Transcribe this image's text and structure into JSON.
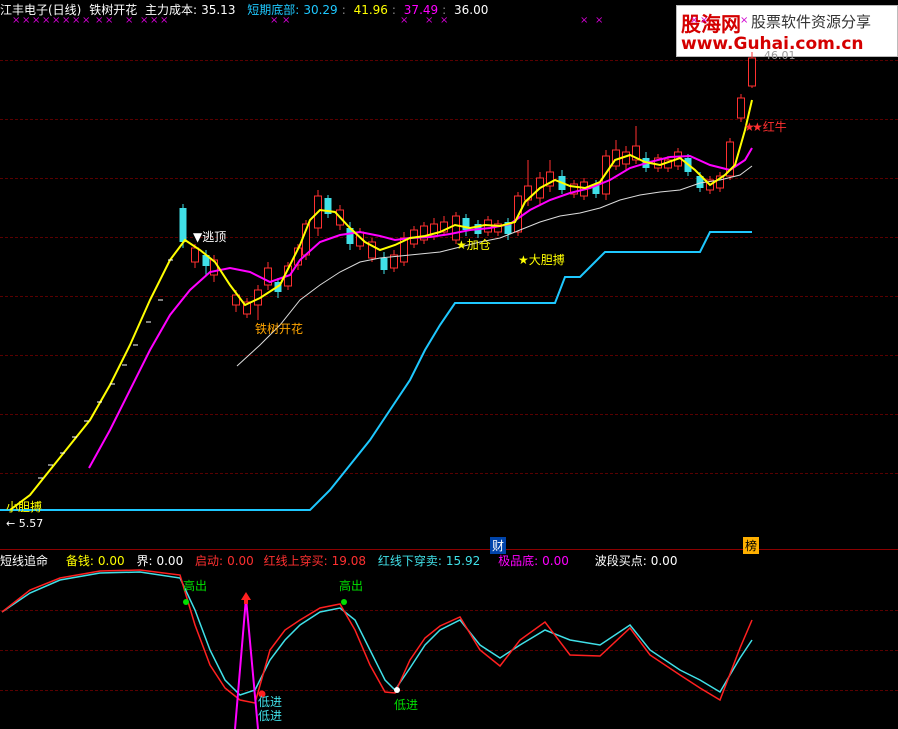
{
  "header": {
    "title": "江丰电子(日线)",
    "indicator": "铁树开花",
    "cost_label": "主力成本:",
    "cost_value": "35.13",
    "bottom_label": "短期底部:",
    "v1": "30.29",
    "v2": "41.96",
    "v3": "37.49",
    "v4": "36.00"
  },
  "sub": {
    "name": "短线追命",
    "bq_label": "备钱:",
    "bq_value": "0.00",
    "jie_label": "界:",
    "jie_value": "0.00",
    "qd_label": "启动:",
    "qd_value": "0.00",
    "up_label": "红线上穿买:",
    "up_value": "19.08",
    "down_label": "红线下穿卖:",
    "down_value": "15.92",
    "jp_label": "极品底:",
    "jp_value": "0.00",
    "bd_label": "波段买点:",
    "bd_value": "0.00"
  },
  "annotations": {
    "escape_top": "▼逃顶",
    "tree_bloom": "铁树开花",
    "add_pos": "★加仓",
    "bold_bet": "★大胆搏",
    "red_bull": "★红牛",
    "small_bold": "小胆搏",
    "low_price": "← 5.57",
    "high_price": "46.01",
    "cai_tag": "财",
    "bang_tag": "榜",
    "gao_chu_1": "高出",
    "gao_chu_2": "高出",
    "di_jin_1": "低进",
    "di_jin_2": "低进",
    "di_jin_3": "低进"
  },
  "watermark": {
    "brand": "股海网",
    "slogan": "股票软件资源分享",
    "url": "www.Guhai.com.cn"
  },
  "colors": {
    "background": "#000000",
    "up_candle": "#ff3030",
    "down_candle": "#40e0e8",
    "yellow_line": "#ffff00",
    "magenta_line": "#ff00ff",
    "white_line": "#ffffff",
    "blue_line": "#1ec8ff",
    "x_marker": "#d000d0"
  }
}
